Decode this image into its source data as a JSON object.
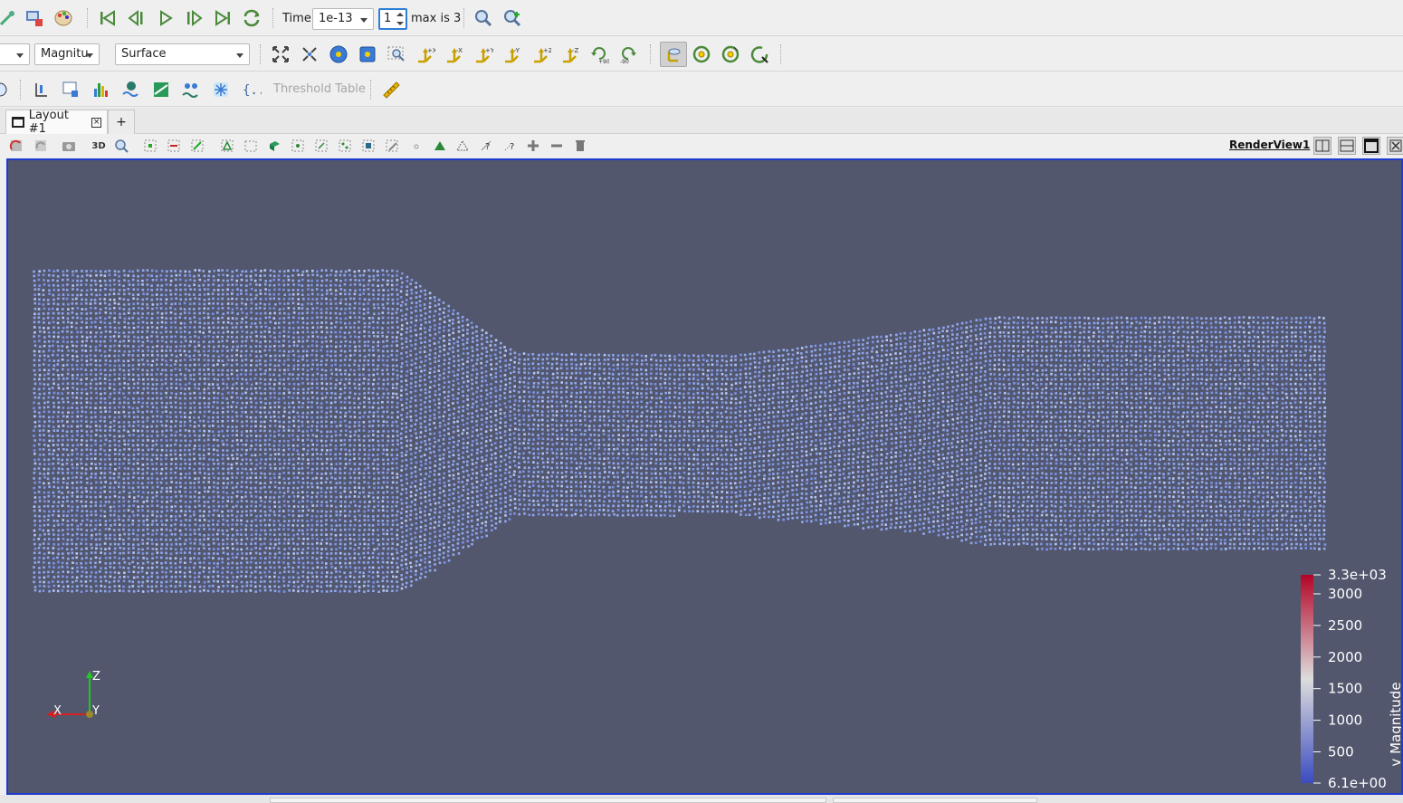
{
  "toolbar1": {
    "time_label": "Time:",
    "time_value": "1e-13",
    "timestep_value": "1",
    "max_label": "max is 3"
  },
  "toolbar2": {
    "array_combo": "Magnitu",
    "representation_combo": "Surface"
  },
  "toolbar3": {
    "threshold_table_label": "Threshold Table"
  },
  "tabs": {
    "layout_tab_label": "Layout #1",
    "add_tab_label": "+"
  },
  "viewbar": {
    "view_name": "RenderView1",
    "mode_3d_label": "3D"
  },
  "axes": {
    "x_label": "X",
    "y_label": "Y",
    "z_label": "Z"
  },
  "colorbar": {
    "title": "v Magnitude",
    "max_label": "3.3e+03",
    "min_label": "6.1e+00",
    "ticks": [
      "3000",
      "2500",
      "2000",
      "1500",
      "1000",
      "500"
    ],
    "range": [
      6.1,
      3300
    ],
    "tick_values": [
      3000,
      2500,
      2000,
      1500,
      1000,
      500
    ],
    "colors": {
      "high": "#b40426",
      "mid": "#dddddd",
      "low": "#3b4cc0"
    }
  },
  "colors": {
    "viewport_bg": "#52576e",
    "point_color": "#8fa6ee",
    "active_border": "#1f3ccf"
  }
}
